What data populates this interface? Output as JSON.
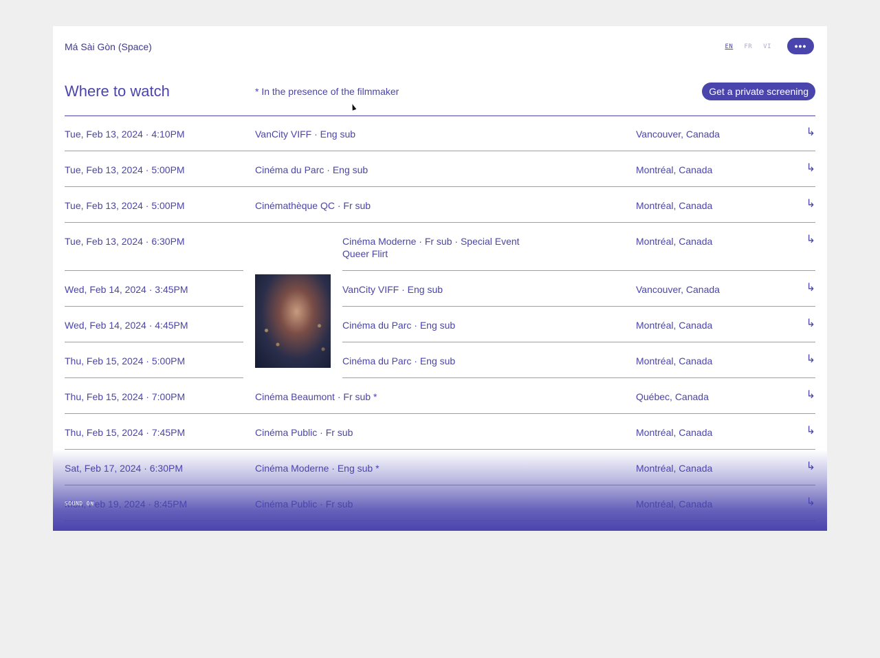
{
  "header": {
    "film_title": "Má Sài Gòn (Space)",
    "languages": [
      "EN",
      "FR",
      "VI"
    ],
    "active_language": "EN",
    "menu_label": "•••"
  },
  "section": {
    "title": "Where to watch",
    "presence_note": "* In the presence of the filmmaker",
    "private_screening_label": "Get a private screening"
  },
  "screenings": [
    {
      "date": "Tue, Feb 13, 2024 · 4:10PM",
      "venue": "VanCity VIFF · Eng sub",
      "city": "Vancouver, Canada",
      "arrow": "↳"
    },
    {
      "date": "Tue, Feb 13, 2024 · 5:00PM",
      "venue": "Cinéma du Parc · Eng sub",
      "city": "Montréal, Canada",
      "arrow": "↳"
    },
    {
      "date": "Tue, Feb 13, 2024 · 5:00PM",
      "venue": "Cinémathèque QC · Fr sub",
      "city": "Montréal, Canada",
      "arrow": "↳"
    },
    {
      "date": "Tue, Feb 13, 2024 · 6:30PM",
      "venue": "Cinéma Moderne · Fr sub · Special Event",
      "venue_line2": "Queer Flirt",
      "city": "Montréal, Canada",
      "arrow": "↳"
    },
    {
      "date": "Wed, Feb 14, 2024 · 3:45PM",
      "venue": "VanCity VIFF · Eng sub",
      "city": "Vancouver, Canada",
      "arrow": "↳"
    },
    {
      "date": "Wed, Feb 14, 2024 · 4:45PM",
      "venue": "Cinéma du Parc · Eng sub",
      "city": "Montréal, Canada",
      "arrow": "↳"
    },
    {
      "date": "Thu, Feb 15, 2024 · 5:00PM",
      "venue": "Cinéma du Parc · Eng sub",
      "city": "Montréal, Canada",
      "arrow": "↳"
    },
    {
      "date": "Thu, Feb 15, 2024 · 7:00PM",
      "venue": "Cinéma Beaumont · Fr sub *",
      "city": "Québec, Canada",
      "arrow": "↳"
    },
    {
      "date": "Thu, Feb 15, 2024 · 7:45PM",
      "venue": "Cinéma Public · Fr sub",
      "city": "Montréal, Canada",
      "arrow": "↳"
    },
    {
      "date": "Sat, Feb 17, 2024 · 6:30PM",
      "venue": "Cinéma Moderne · Eng sub *",
      "city": "Montréal, Canada",
      "arrow": "↳"
    },
    {
      "date": "Mon, Feb 19, 2024 · 8:45PM",
      "venue": "Cinéma Public · Fr sub",
      "city": "Montréal, Canada",
      "arrow": "↳"
    }
  ],
  "sound_toggle": "SOUND ON"
}
